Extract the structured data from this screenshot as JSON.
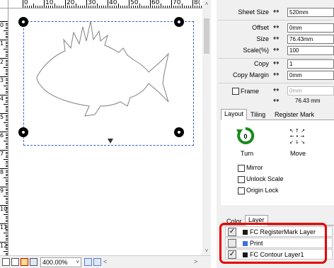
{
  "ruler": {
    "h_labels": [
      "0",
      "10",
      "20",
      "30",
      "40",
      "50",
      "60",
      "70",
      "8("
    ],
    "v_labels": [
      "0",
      "1",
      "2",
      "3",
      "4",
      "5",
      "6",
      "7",
      "8",
      "9",
      "10",
      "11",
      "12",
      "13"
    ]
  },
  "zoom": {
    "value": "400.00%"
  },
  "properties": {
    "sheet_size": {
      "label": "Sheet Size",
      "value": "520mm"
    },
    "offset": {
      "label": "Offset",
      "value": "0mm"
    },
    "size": {
      "label": "Size",
      "value": "76.43mm"
    },
    "scale": {
      "label": "Scale(%)",
      "value": "100"
    },
    "copy": {
      "label": "Copy",
      "value": "1"
    },
    "copy_margin": {
      "label": "Copy Margin",
      "value": "0mm"
    },
    "frame": {
      "label": "Frame",
      "value": "0mm",
      "width_value": "76.43 mm"
    }
  },
  "tabs": [
    "Layout",
    "Tiling",
    "Register Mark"
  ],
  "layout": {
    "turn_label": "Turn",
    "turn_value": "0",
    "move_label": "Move",
    "options": [
      "Mirror",
      "Unlock Scale",
      "Origin Lock"
    ]
  },
  "tabs2": [
    "Color",
    "Layer"
  ],
  "layers": [
    {
      "name": "FC RegisterMark Layer",
      "checked": true,
      "color": "#1a1a1a"
    },
    {
      "name": "Print",
      "checked": false,
      "color": "#3a6fe0"
    },
    {
      "name": "FC Contour Layer1",
      "checked": true,
      "color": "#1a1a1a"
    }
  ],
  "colors": {
    "highlight": "#e60000",
    "sheet_border": "#3a5fcd"
  },
  "icons": {
    "scroll_up": "chevron-up-icon",
    "scroll_down": "chevron-down-icon",
    "turn": "rotate-icon",
    "move": "move-arrows-icon",
    "sheet_pointer": "triangle-down-icon"
  }
}
